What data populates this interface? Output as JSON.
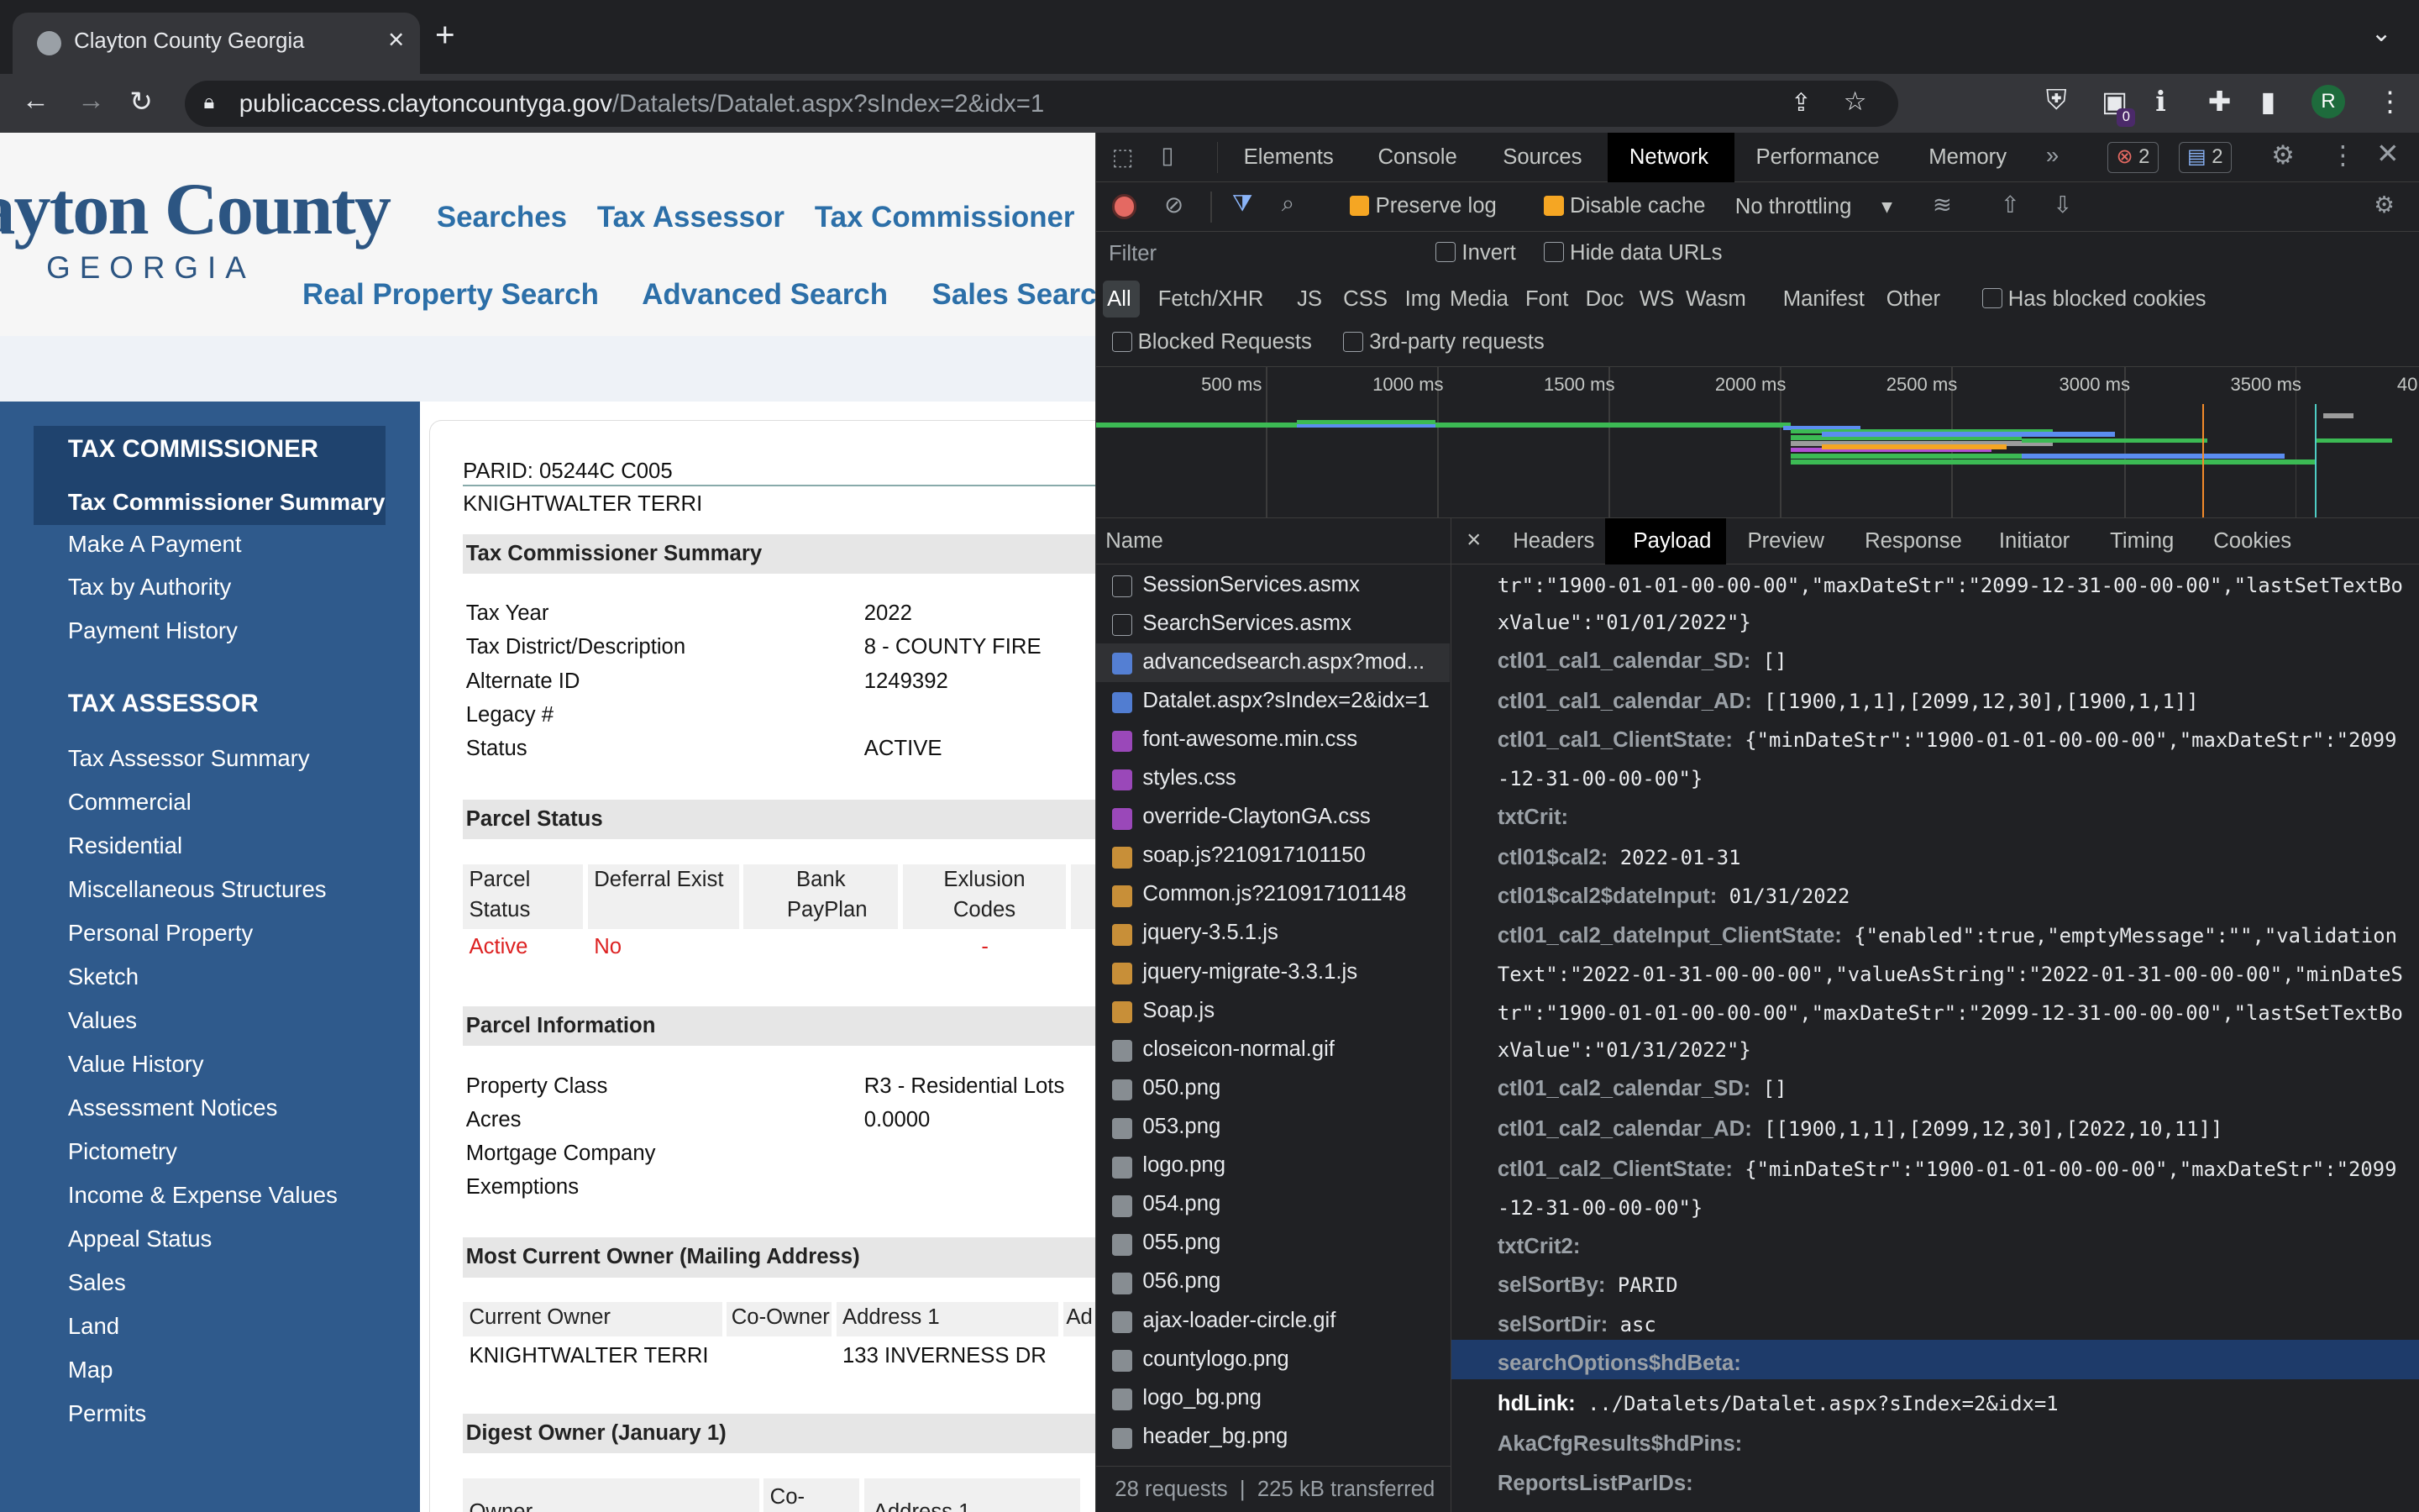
{
  "browser": {
    "tab_title": "Clayton County Georgia",
    "url_host": "publicaccess.claytoncountyga.gov",
    "url_path": "/Datalets/Datalet.aspx?sIndex=2&idx=1",
    "ext_badge": "0",
    "profile": "R"
  },
  "site": {
    "logo_line1": "ayton County",
    "logo_line2": "GEORGIA",
    "nav_top": [
      "Searches",
      "Tax Assessor",
      "Tax Commissioner"
    ],
    "nav_sub": [
      "Real Property Search",
      "Advanced Search",
      "Sales Searc"
    ],
    "sidebar": {
      "head1": "TAX COMMISSIONER",
      "active": "Tax Commissioner Summary",
      "group1": [
        "Make A Payment",
        "Tax by Authority",
        "Payment History"
      ],
      "head2": "TAX ASSESSOR",
      "group2": [
        "Tax Assessor Summary",
        "Commercial",
        "Residential",
        "Miscellaneous Structures",
        "Personal Property",
        "Sketch",
        "Values",
        "Value History",
        "Assessment Notices",
        "Pictometry",
        "Income & Expense Values",
        "Appeal Status",
        "Sales",
        "Land",
        "Map",
        "Permits"
      ]
    },
    "parid": "PARID: 05244C C005",
    "owner_name": "KNIGHTWALTER TERRI",
    "sec_tcs": "Tax Commissioner Summary",
    "tcs_labels": [
      "Tax Year",
      "Tax District/Description",
      "Alternate ID",
      "Legacy #",
      "Status"
    ],
    "tcs_values": [
      "2022",
      "8 - COUNTY FIRE",
      "1249392",
      "",
      "ACTIVE"
    ],
    "sec_ps": "Parcel Status",
    "ps_head": [
      "Parcel Status",
      "Deferral Exist",
      "Bank PayPlan",
      "Exlusion Codes"
    ],
    "ps_vals": [
      "Active",
      "No",
      "",
      "-"
    ],
    "sec_pi": "Parcel Information",
    "pi_labels": [
      "Property Class",
      "Acres",
      "Mortgage Company",
      "Exemptions"
    ],
    "pi_values": [
      "R3 - Residential Lots",
      "0.0000",
      "",
      ""
    ],
    "sec_mco": "Most Current Owner (Mailing Address)",
    "mco_head": [
      "Current Owner",
      "Co-Owner",
      "Address 1",
      "Ad"
    ],
    "mco_vals": [
      "KNIGHTWALTER TERRI",
      "",
      "133 INVERNESS DR"
    ],
    "sec_do": "Digest Owner (January 1)",
    "do_head": [
      "Owner",
      "Co-",
      "Address 1"
    ]
  },
  "devtools": {
    "tabs": [
      "Elements",
      "Console",
      "Sources",
      "Network",
      "Performance",
      "Memory"
    ],
    "errors": "2",
    "messages": "2",
    "preserve_log": "Preserve log",
    "disable_cache": "Disable cache",
    "throttling": "No throttling",
    "filter_placeholder": "Filter",
    "invert": "Invert",
    "hide_data": "Hide data URLs",
    "types": [
      "All",
      "Fetch/XHR",
      "JS",
      "CSS",
      "Img",
      "Media",
      "Font",
      "Doc",
      "WS",
      "Wasm",
      "Manifest",
      "Other"
    ],
    "blocked_cookies": "Has blocked cookies",
    "blocked_requests": "Blocked Requests",
    "third_party": "3rd-party requests",
    "timeline_ticks": [
      "500 ms",
      "1000 ms",
      "1500 ms",
      "2000 ms",
      "2500 ms",
      "3000 ms",
      "3500 ms",
      "40"
    ],
    "name_header": "Name",
    "requests": [
      {
        "name": "SessionServices.asmx",
        "icon": "doc"
      },
      {
        "name": "SearchServices.asmx",
        "icon": "doc"
      },
      {
        "name": "advancedsearch.aspx?mod...",
        "icon": "html"
      },
      {
        "name": "Datalet.aspx?sIndex=2&idx=1",
        "icon": "html"
      },
      {
        "name": "font-awesome.min.css",
        "icon": "css"
      },
      {
        "name": "styles.css",
        "icon": "css"
      },
      {
        "name": "override-ClaytonGA.css",
        "icon": "css"
      },
      {
        "name": "soap.js?210917101150",
        "icon": "js"
      },
      {
        "name": "Common.js?210917101148",
        "icon": "js"
      },
      {
        "name": "jquery-3.5.1.js",
        "icon": "js"
      },
      {
        "name": "jquery-migrate-3.3.1.js",
        "icon": "js"
      },
      {
        "name": "Soap.js",
        "icon": "js"
      },
      {
        "name": "closeicon-normal.gif",
        "icon": "img"
      },
      {
        "name": "050.png",
        "icon": "img"
      },
      {
        "name": "053.png",
        "icon": "img"
      },
      {
        "name": "logo.png",
        "icon": "img"
      },
      {
        "name": "054.png",
        "icon": "img"
      },
      {
        "name": "055.png",
        "icon": "img"
      },
      {
        "name": "056.png",
        "icon": "img"
      },
      {
        "name": "ajax-loader-circle.gif",
        "icon": "img"
      },
      {
        "name": "countylogo.png",
        "icon": "img"
      },
      {
        "name": "logo_bg.png",
        "icon": "img"
      },
      {
        "name": "header_bg.png",
        "icon": "img"
      }
    ],
    "summary_requests": "28 requests",
    "summary_transferred": "225 kB transferred",
    "detail_tabs": [
      "Headers",
      "Payload",
      "Preview",
      "Response",
      "Initiator",
      "Timing",
      "Cookies"
    ],
    "payload_wrap1": "tr\":\"1900-01-01-00-00-00\",\"maxDateStr\":\"2099-12-31-00-00-00\",\"lastSetTextBo",
    "payload_wrap2": "xValue\":\"01/01/2022\"}",
    "p1k": "ctl01_cal1_calendar_SD:",
    "p1v": "[]",
    "p2k": "ctl01_cal1_calendar_AD:",
    "p2v": "[[1900,1,1],[2099,12,30],[1900,1,1]]",
    "p3k": "ctl01_cal1_ClientState:",
    "p3v": "{\"minDateStr\":\"1900-01-01-00-00-00\",\"maxDateStr\":\"2099",
    "p3w": "-12-31-00-00-00\"}",
    "p4k": "txtCrit:",
    "p5k": "ctl01$cal2:",
    "p5v": "2022-01-31",
    "p6k": "ctl01$cal2$dateInput:",
    "p6v": "01/31/2022",
    "p7k": "ctl01_cal2_dateInput_ClientState:",
    "p7v": "{\"enabled\":true,\"emptyMessage\":\"\",\"validation",
    "p7w1": "Text\":\"2022-01-31-00-00-00\",\"valueAsString\":\"2022-01-31-00-00-00\",\"minDateS",
    "p7w2": "tr\":\"1900-01-01-00-00-00\",\"maxDateStr\":\"2099-12-31-00-00-00\",\"lastSetTextBo",
    "p7w3": "xValue\":\"01/31/2022\"}",
    "p8k": "ctl01_cal2_calendar_SD:",
    "p8v": "[]",
    "p9k": "ctl01_cal2_calendar_AD:",
    "p9v": "[[1900,1,1],[2099,12,30],[2022,10,11]]",
    "p10k": "ctl01_cal2_ClientState:",
    "p10v": "{\"minDateStr\":\"1900-01-01-00-00-00\",\"maxDateStr\":\"2099",
    "p10w": "-12-31-00-00-00\"}",
    "p11k": "txtCrit2:",
    "p12k": "selSortBy:",
    "p12v": "PARID",
    "p13k": "selSortDir:",
    "p13v": "asc",
    "p14k": "searchOptions$hdBeta:",
    "p15k": "hdLink:",
    "p15v": "../Datalets/Datalet.aspx?sIndex=2&idx=1",
    "p16k": "AkaCfgResults$hdPins:",
    "p17k": "ReportsListParIDs:"
  },
  "colors": {
    "devtools_bg": "#202124",
    "sidebar": "#2f5a8c",
    "link": "#2c6fa8",
    "orange": "#f5a623"
  }
}
